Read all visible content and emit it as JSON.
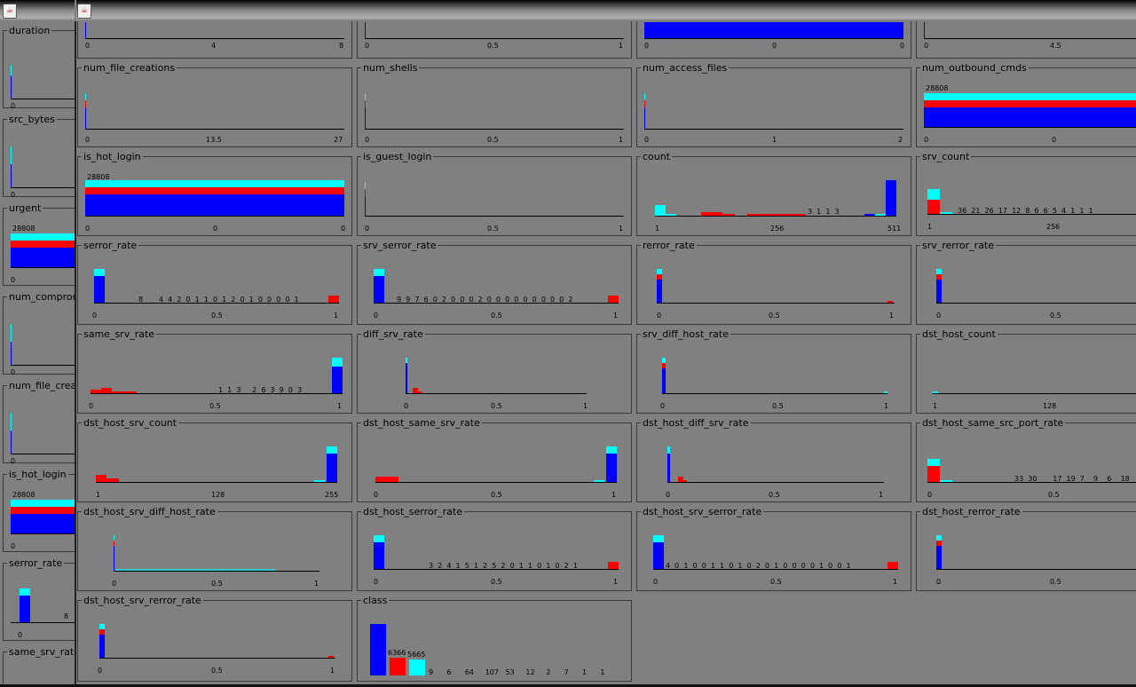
{
  "windows": {
    "w1_icon": "java-icon",
    "w2_icon": "java-icon"
  },
  "colors": {
    "class_a": "#0000ff",
    "class_b": "#ff0000",
    "class_c": "#00ffff",
    "background": "#808080"
  },
  "left_panels": [
    {
      "title": "duration",
      "tick0": "0"
    },
    {
      "title": "src_bytes",
      "tick0": "0"
    },
    {
      "title": "urgent",
      "tick0": "0",
      "count": "28808"
    },
    {
      "title": "num_compromi",
      "tick0": "0"
    },
    {
      "title": "num_file_creat",
      "tick0": "0"
    },
    {
      "title": "is_hot_login",
      "tick0": "0",
      "count": "28808"
    },
    {
      "title": "serror_rate",
      "tick0": "0",
      "n1": "8"
    },
    {
      "title": "same_srv_rate"
    }
  ],
  "main_panels": [
    {
      "title": "",
      "ticks": [
        "0",
        "4",
        "8"
      ]
    },
    {
      "title": "",
      "ticks": [
        "0",
        "0.5",
        "1"
      ]
    },
    {
      "title": "",
      "ticks": [
        "0",
        "0",
        "0"
      ]
    },
    {
      "title": "",
      "ticks": [
        "0",
        "4.5"
      ]
    },
    {
      "title": "num_file_creations",
      "ticks": [
        "0",
        "13.5",
        "27"
      ]
    },
    {
      "title": "num_shells",
      "ticks": [
        "0",
        "0.5",
        "1"
      ]
    },
    {
      "title": "num_access_files",
      "ticks": [
        "0",
        "1",
        "2"
      ]
    },
    {
      "title": "num_outbound_cmds",
      "ticks": [
        "0",
        "0"
      ],
      "count": "28808"
    },
    {
      "title": "is_hot_login",
      "ticks": [
        "0",
        "0",
        "0"
      ],
      "count": "28808"
    },
    {
      "title": "is_guest_login",
      "ticks": [
        "0",
        "0.5",
        "1"
      ]
    },
    {
      "title": "count",
      "ticks": [
        "1",
        "256",
        "511"
      ],
      "nums": "3  1  1  3"
    },
    {
      "title": "srv_count",
      "ticks": [
        "1",
        "256"
      ],
      "nums": "36  21  26  17  12  8  6  6  5  4  1  1  1"
    },
    {
      "title": "serror_rate",
      "ticks": [
        "0",
        "0.5",
        "1"
      ],
      "nums": "8       4  4  2  0  1  1  0  1  2  0  1  0  0  0  0  1"
    },
    {
      "title": "srv_serror_rate",
      "ticks": [
        "0",
        "0.5",
        "1"
      ],
      "nums": "9  9  7  6  0  2  0  0  0  2  0  0  0  0  0  0  0  0  0  2"
    },
    {
      "title": "rerror_rate",
      "ticks": [
        "0",
        "0.5",
        "1"
      ]
    },
    {
      "title": "srv_rerror_rate",
      "ticks": [
        "0",
        "0.5"
      ]
    },
    {
      "title": "same_srv_rate",
      "ticks": [
        "0",
        "0.5",
        "1"
      ],
      "nums": "1  1  3     2  6  3  9  0  3"
    },
    {
      "title": "diff_srv_rate",
      "ticks": [
        "0",
        "0.5",
        "1"
      ]
    },
    {
      "title": "srv_diff_host_rate",
      "ticks": [
        "0",
        "0.5",
        "1"
      ]
    },
    {
      "title": "dst_host_count",
      "ticks": [
        "1",
        "128"
      ]
    },
    {
      "title": "dst_host_srv_count",
      "ticks": [
        "1",
        "128",
        "255"
      ]
    },
    {
      "title": "dst_host_same_srv_rate",
      "ticks": [
        "0",
        "0.5",
        "1"
      ]
    },
    {
      "title": "dst_host_diff_srv_rate",
      "ticks": [
        "0",
        "0.5",
        "1"
      ]
    },
    {
      "title": "dst_host_same_src_port_rate",
      "ticks": [
        "0",
        "0.5"
      ],
      "nums": "33  30       17  19  7    9    6    18"
    },
    {
      "title": "dst_host_srv_diff_host_rate",
      "ticks": [
        "0",
        "0.5",
        "1"
      ]
    },
    {
      "title": "dst_host_serror_rate",
      "ticks": [
        "0",
        "0.5",
        "1"
      ],
      "nums": "3  2  4  1  5  1  2  5  2  0  1  1  0  1  0  2  1"
    },
    {
      "title": "dst_host_srv_serror_rate",
      "ticks": [
        "0",
        "0.5",
        "1"
      ],
      "nums": "4  0  1  0  0  1  1  0  1  0  2  0  1  0  0  0  0  1  0  0  1"
    },
    {
      "title": "dst_host_rerror_rate",
      "ticks": [
        "0",
        "0.5"
      ]
    },
    {
      "title": "dst_host_srv_rerror_rate",
      "ticks": [
        "0",
        "0.5",
        "1"
      ]
    },
    {
      "title": "class",
      "ticks": [],
      "n_red": "6366",
      "n_cyan": "5665",
      "nums": "9      6      64     107   53     12     2      7      1      1"
    }
  ]
}
